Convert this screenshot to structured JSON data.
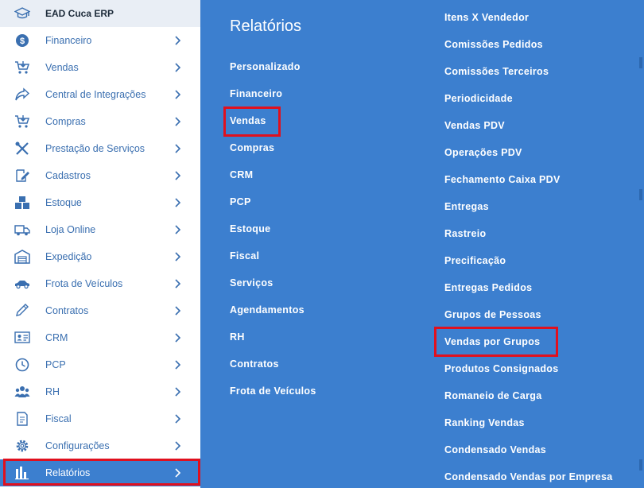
{
  "brand": {
    "title": "EAD Cuca ERP",
    "icon": "graduation-cap-icon"
  },
  "sidebar": {
    "items": [
      {
        "label": "Financeiro",
        "icon": "dollar-icon"
      },
      {
        "label": "Vendas",
        "icon": "cart-icon"
      },
      {
        "label": "Central de Integrações",
        "icon": "share-icon"
      },
      {
        "label": "Compras",
        "icon": "cart-icon"
      },
      {
        "label": "Prestação de Serviços",
        "icon": "tools-icon"
      },
      {
        "label": "Cadastros",
        "icon": "edit-icon"
      },
      {
        "label": "Estoque",
        "icon": "boxes-icon"
      },
      {
        "label": "Loja Online",
        "icon": "truck-icon"
      },
      {
        "label": "Expedição",
        "icon": "warehouse-icon"
      },
      {
        "label": "Frota de Veículos",
        "icon": "car-icon"
      },
      {
        "label": "Contratos",
        "icon": "pencil-icon"
      },
      {
        "label": "CRM",
        "icon": "id-card-icon"
      },
      {
        "label": "PCP",
        "icon": "clock-icon"
      },
      {
        "label": "RH",
        "icon": "users-icon"
      },
      {
        "label": "Fiscal",
        "icon": "document-icon"
      },
      {
        "label": "Configurações",
        "icon": "gear-icon"
      },
      {
        "label": "Relatórios",
        "icon": "bar-chart-icon",
        "active": true
      }
    ]
  },
  "panel": {
    "title": "Relatórios",
    "col1": [
      "Personalizado",
      "Financeiro",
      "Vendas",
      "Compras",
      "CRM",
      "PCP",
      "Estoque",
      "Fiscal",
      "Serviços",
      "Agendamentos",
      "RH",
      "Contratos",
      "Frota de Veículos"
    ],
    "col2": [
      "Itens X Vendedor",
      "Comissões Pedidos",
      "Comissões Terceiros",
      "Periodicidade",
      "Vendas PDV",
      "Operações PDV",
      "Fechamento Caixa PDV",
      "Entregas",
      "Rastreio",
      "Precificação",
      "Entregas Pedidos",
      "Grupos de Pessoas",
      "Vendas por Grupos",
      "Produtos Consignados",
      "Romaneio de Carga",
      "Ranking Vendas",
      "Condensado Vendas",
      "Condensado Vendas por Empresa"
    ]
  },
  "colors": {
    "accent": "#3c7fcf",
    "highlight": "#e0101e",
    "sidebar_text": "#3a6fb0"
  }
}
